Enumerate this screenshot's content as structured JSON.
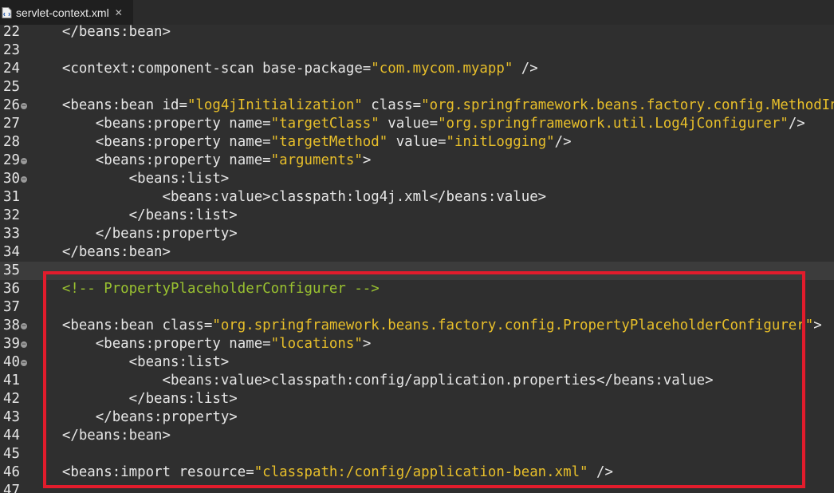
{
  "tab": {
    "title": "servlet-context.xml",
    "close_symbol": "✕"
  },
  "editor": {
    "lines": [
      {
        "num": "22",
        "fold": false,
        "indent": "    ",
        "segments": [
          {
            "text": "</beans:bean>",
            "kind": "t"
          }
        ]
      },
      {
        "num": "23",
        "fold": false,
        "indent": "",
        "segments": []
      },
      {
        "num": "24",
        "fold": false,
        "indent": "    ",
        "segments": [
          {
            "text": "<context:component-scan base-package=",
            "kind": "t"
          },
          {
            "text": "\"com.mycom.myapp\"",
            "kind": "s"
          },
          {
            "text": " />",
            "kind": "t"
          }
        ]
      },
      {
        "num": "25",
        "fold": false,
        "indent": "",
        "segments": []
      },
      {
        "num": "26",
        "fold": true,
        "indent": "    ",
        "segments": [
          {
            "text": "<beans:bean id=",
            "kind": "t"
          },
          {
            "text": "\"log4jInitialization\"",
            "kind": "s"
          },
          {
            "text": " class=",
            "kind": "t"
          },
          {
            "text": "\"org.springframework.beans.factory.config.MethodInvokingFactoryBean\"",
            "kind": "s"
          },
          {
            "text": ">",
            "kind": "t"
          }
        ]
      },
      {
        "num": "27",
        "fold": false,
        "indent": "        ",
        "segments": [
          {
            "text": "<beans:property name=",
            "kind": "t"
          },
          {
            "text": "\"targetClass\"",
            "kind": "s"
          },
          {
            "text": " value=",
            "kind": "t"
          },
          {
            "text": "\"org.springframework.util.Log4jConfigurer\"",
            "kind": "s"
          },
          {
            "text": "/>",
            "kind": "t"
          }
        ]
      },
      {
        "num": "28",
        "fold": false,
        "indent": "        ",
        "segments": [
          {
            "text": "<beans:property name=",
            "kind": "t"
          },
          {
            "text": "\"targetMethod\"",
            "kind": "s"
          },
          {
            "text": " value=",
            "kind": "t"
          },
          {
            "text": "\"initLogging\"",
            "kind": "s"
          },
          {
            "text": "/>",
            "kind": "t"
          }
        ]
      },
      {
        "num": "29",
        "fold": true,
        "indent": "        ",
        "segments": [
          {
            "text": "<beans:property name=",
            "kind": "t"
          },
          {
            "text": "\"arguments\"",
            "kind": "s"
          },
          {
            "text": ">",
            "kind": "t"
          }
        ]
      },
      {
        "num": "30",
        "fold": true,
        "indent": "            ",
        "segments": [
          {
            "text": "<beans:list>",
            "kind": "t"
          }
        ]
      },
      {
        "num": "31",
        "fold": false,
        "indent": "                ",
        "segments": [
          {
            "text": "<beans:value>classpath:log4j.xml</beans:value>",
            "kind": "t"
          }
        ]
      },
      {
        "num": "32",
        "fold": false,
        "indent": "            ",
        "segments": [
          {
            "text": "</beans:list>",
            "kind": "t"
          }
        ]
      },
      {
        "num": "33",
        "fold": false,
        "indent": "        ",
        "segments": [
          {
            "text": "</beans:property>",
            "kind": "t"
          }
        ]
      },
      {
        "num": "34",
        "fold": false,
        "indent": "    ",
        "segments": [
          {
            "text": "</beans:bean>",
            "kind": "t"
          }
        ]
      },
      {
        "num": "35",
        "fold": false,
        "indent": "",
        "segments": [],
        "current": true
      },
      {
        "num": "36",
        "fold": false,
        "indent": "    ",
        "segments": [
          {
            "text": "<!-- PropertyPlaceholderConfigurer -->",
            "kind": "c"
          }
        ]
      },
      {
        "num": "37",
        "fold": false,
        "indent": "",
        "segments": []
      },
      {
        "num": "38",
        "fold": true,
        "indent": "    ",
        "segments": [
          {
            "text": "<beans:bean class=",
            "kind": "t"
          },
          {
            "text": "\"org.springframework.beans.factory.config.PropertyPlaceholderConfigurer\"",
            "kind": "s"
          },
          {
            "text": ">",
            "kind": "t"
          }
        ]
      },
      {
        "num": "39",
        "fold": true,
        "indent": "        ",
        "segments": [
          {
            "text": "<beans:property name=",
            "kind": "t"
          },
          {
            "text": "\"locations\"",
            "kind": "s"
          },
          {
            "text": ">",
            "kind": "t"
          }
        ]
      },
      {
        "num": "40",
        "fold": true,
        "indent": "            ",
        "segments": [
          {
            "text": "<beans:list>",
            "kind": "t"
          }
        ]
      },
      {
        "num": "41",
        "fold": false,
        "indent": "                ",
        "segments": [
          {
            "text": "<beans:value>classpath:config/application.properties</beans:value>",
            "kind": "t"
          }
        ]
      },
      {
        "num": "42",
        "fold": false,
        "indent": "            ",
        "segments": [
          {
            "text": "</beans:list>",
            "kind": "t"
          }
        ]
      },
      {
        "num": "43",
        "fold": false,
        "indent": "        ",
        "segments": [
          {
            "text": "</beans:property>",
            "kind": "t"
          }
        ]
      },
      {
        "num": "44",
        "fold": false,
        "indent": "    ",
        "segments": [
          {
            "text": "</beans:bean>",
            "kind": "t"
          }
        ]
      },
      {
        "num": "45",
        "fold": false,
        "indent": "",
        "segments": []
      },
      {
        "num": "46",
        "fold": false,
        "indent": "    ",
        "segments": [
          {
            "text": "<beans:import resource=",
            "kind": "t"
          },
          {
            "text": "\"classpath:/config/application-bean.xml\"",
            "kind": "s"
          },
          {
            "text": " />",
            "kind": "t"
          }
        ]
      },
      {
        "num": "47",
        "fold": false,
        "indent": "",
        "segments": []
      }
    ]
  },
  "colors": {
    "background": "#2f2f2f",
    "text": "#e6e6e6",
    "string": "#e8bf2a",
    "comment": "#9ac230",
    "highlight_border": "#e21c2c"
  },
  "icons": {
    "file": "xml-file-icon",
    "fold": "fold-collapse-icon"
  }
}
